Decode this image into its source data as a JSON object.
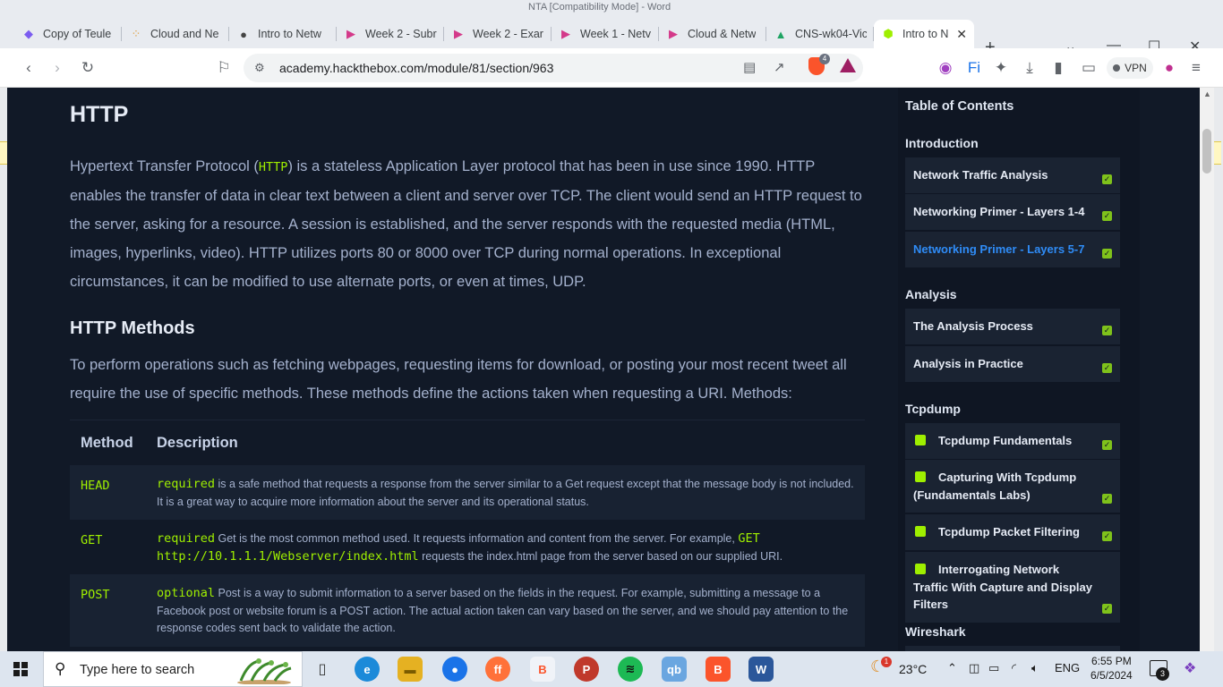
{
  "window": {
    "title": "NTA [Compatibility Mode] - Word"
  },
  "tabs": [
    {
      "label": "Copy of Teule",
      "icon": "copilot-icon",
      "color": "#7b5cf0"
    },
    {
      "label": "Cloud and Ne",
      "icon": "dots-icon",
      "color": "#e0a040"
    },
    {
      "label": "Intro to Netw",
      "icon": "globe-icon",
      "color": "#444444"
    },
    {
      "label": "Week 2 - Subr",
      "icon": "play-icon",
      "color": "#d43a8a"
    },
    {
      "label": "Week 2 - Exar",
      "icon": "play-icon",
      "color": "#d43a8a"
    },
    {
      "label": "Week 1 - Netv",
      "icon": "play-icon",
      "color": "#d43a8a"
    },
    {
      "label": "Cloud & Netw",
      "icon": "play-icon",
      "color": "#d43a8a"
    },
    {
      "label": "CNS-wk04-Vic",
      "icon": "drive-icon",
      "color": "#1fa463"
    },
    {
      "label": "Intro to N",
      "icon": "cube-icon",
      "color": "#9fef00"
    }
  ],
  "address_bar": {
    "url": "academy.hackthebox.com/module/81/section/963",
    "brave_badge": "4",
    "vpn_label": "VPN"
  },
  "article": {
    "title": "HTTP",
    "intro_before": "Hypertext Transfer Protocol (",
    "intro_code": "HTTP",
    "intro_after": ") is a stateless Application Layer protocol that has been in use since 1990. HTTP enables the transfer of data in clear text between a client and server over TCP. The client would send an HTTP request to the server, asking for a resource. A session is established, and the server responds with the requested media (HTML, images, hyperlinks, video). HTTP utilizes ports 80 or 8000 over TCP during normal operations. In exceptional circumstances, it can be modified to use alternate ports, or even at times, UDP.",
    "methods_title": "HTTP Methods",
    "methods_intro": "To perform operations such as fetching webpages, requesting items for download, or posting your most recent tweet all require the use of specific methods. These methods define the actions taken when requesting a URI. Methods:",
    "table": {
      "headers": [
        "Method",
        "Description"
      ],
      "rows": [
        {
          "method": "HEAD",
          "tag": "required",
          "text": " is a safe method that requests a response from the server similar to a Get request except that the message body is not included. It is a great way to acquire more information about the server and its operational status."
        },
        {
          "method": "GET",
          "tag": "required",
          "text": " Get is the most common method used. It requests information and content from the server. For example, ",
          "code": "GET http://10.1.1.1/Webserver/index.html",
          "text2": " requests the index.html page from the server based on our supplied URI."
        },
        {
          "method": "POST",
          "tag": "optional",
          "text": " Post is a way to submit information to a server based on the fields in the request. For example, submitting a message to a Facebook post or website forum is a POST action. The actual action taken can vary based on the server, and we should pay attention to the response codes sent back to validate the action."
        }
      ]
    }
  },
  "toc": {
    "title": "Table of Contents",
    "sections": [
      {
        "name": "Introduction",
        "items": [
          "Network Traffic Analysis",
          "Networking Primer - Layers 1-4",
          "Networking Primer - Layers 5-7"
        ]
      },
      {
        "name": "Analysis",
        "items": [
          "The Analysis Process",
          "Analysis in Practice"
        ]
      },
      {
        "name": "Tcpdump",
        "items": [
          "Tcpdump Fundamentals",
          "Capturing With Tcpdump (Fundamentals Labs)",
          "Tcpdump Packet Filtering",
          "Interrogating Network Traffic With Capture and Display Filters"
        ]
      },
      {
        "name": "Wireshark",
        "items": []
      }
    ],
    "current_item": "Networking Primer - Layers 5-7"
  },
  "taskbar": {
    "search_placeholder": "Type here to search",
    "weather": "23°C",
    "weather_badge": "1",
    "language": "ENG",
    "time": "6:55 PM",
    "date": "6/5/2024",
    "notification_count": "3",
    "apps": [
      {
        "name": "task-view",
        "label": "▯",
        "color": "#333333"
      },
      {
        "name": "edge",
        "label": "e",
        "color": "#1c8ad9"
      },
      {
        "name": "file-explorer",
        "label": "▬",
        "color": "#e5b122"
      },
      {
        "name": "chrome-canary",
        "label": "●",
        "color": "#1a73e8"
      },
      {
        "name": "firefox",
        "label": "ff",
        "color": "#ff7139"
      },
      {
        "name": "brave-beta",
        "label": "B",
        "color": "#fb542b"
      },
      {
        "name": "pdf-app",
        "label": "P",
        "color": "#c0392b"
      },
      {
        "name": "spotify",
        "label": "≋",
        "color": "#1db954"
      },
      {
        "name": "qbittorrent",
        "label": "qb",
        "color": "#3d8ddb"
      },
      {
        "name": "brave",
        "label": "B",
        "color": "#fb542b"
      },
      {
        "name": "word",
        "label": "W",
        "color": "#2b579a"
      }
    ]
  }
}
